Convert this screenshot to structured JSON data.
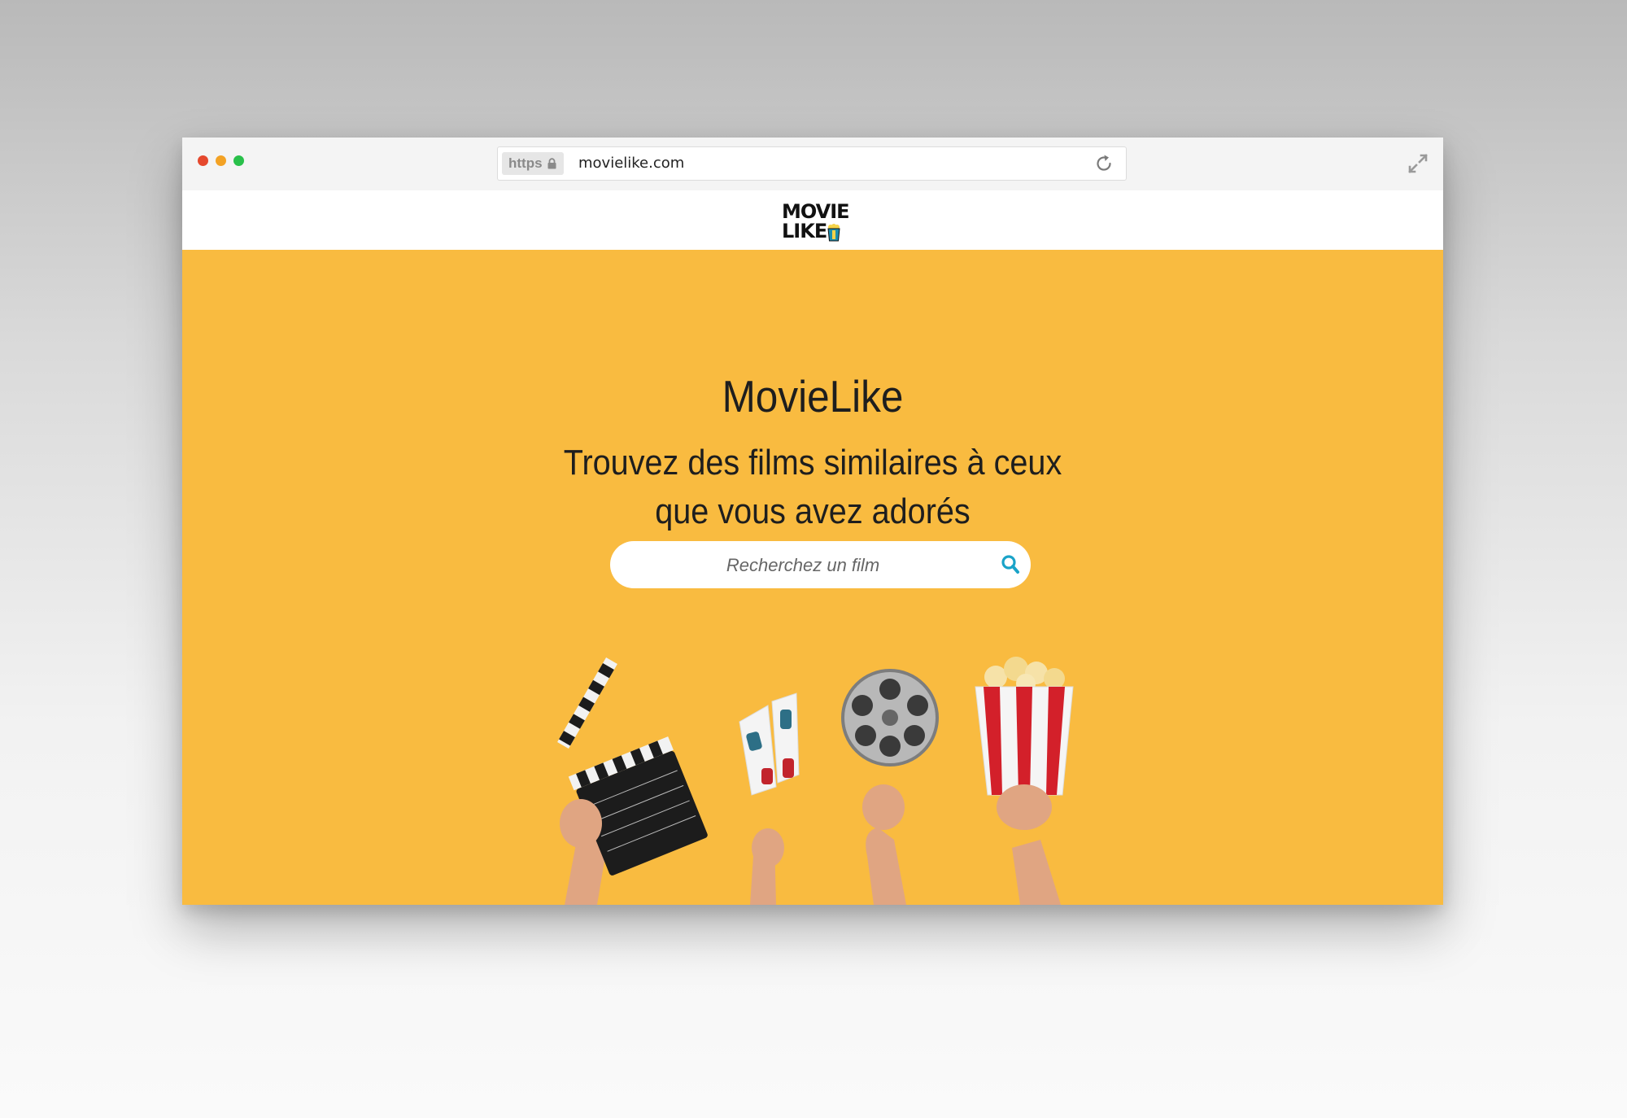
{
  "browser": {
    "https_label": "https",
    "url": "movielike.com"
  },
  "site": {
    "logo_line1": "MOVIE",
    "logo_line2": "LIKE",
    "hero_title": "MovieLike",
    "hero_subtitle": "Trouvez des films similaires à ceux que vous avez adorés",
    "search_placeholder": "Recherchez un film"
  },
  "colors": {
    "hero_background": "#f9bb40",
    "search_icon": "#1aa3c8"
  },
  "icons": [
    "lock-icon",
    "reload-icon",
    "expand-icon",
    "search-icon"
  ]
}
